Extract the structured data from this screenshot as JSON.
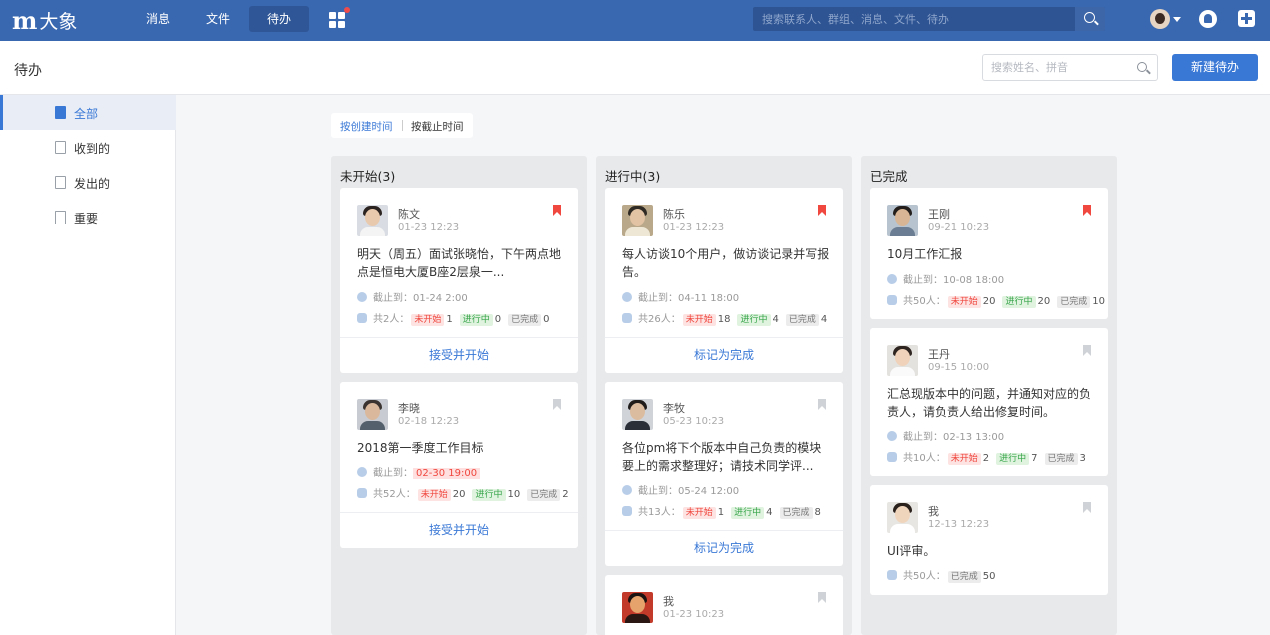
{
  "app": {
    "logo_mark": "m",
    "logo_text": "大象",
    "nav_tabs": [
      "消息",
      "文件",
      "待办"
    ],
    "global_search_placeholder": "搜索联系人、群组、消息、文件、待办"
  },
  "header": {
    "title": "待办",
    "search_placeholder": "搜索姓名、拼音",
    "new_button": "新建待办"
  },
  "sidebar": {
    "items": [
      "全部",
      "收到的",
      "发出的",
      "重要"
    ]
  },
  "sort": {
    "options": [
      "按创建时间",
      "按截止时间"
    ]
  },
  "colors": {
    "brand": "#3a68b0",
    "accent": "#3a78d6",
    "important": "#f0473f"
  },
  "columns": [
    {
      "title": "未开始(3)",
      "cards": [
        {
          "name": "陈文",
          "time": "01-23 12:23",
          "title": "明天（周五）面试张晓怡，下午两点地点是恒电大厦B座2层泉一...",
          "deadline_label": "截止到：",
          "deadline": "01-24 2:00",
          "total": "共2人：",
          "not_started_label": "未开始",
          "not_started": "1",
          "in_progress_label": "进行中",
          "in_progress": "0",
          "done_label": "已完成",
          "done": "0",
          "action": "接受并开始",
          "important": true
        },
        {
          "name": "李晓",
          "time": "02-18 12:23",
          "title": "2018第一季度工作目标",
          "deadline_label": "截止到：",
          "deadline": "02-30 19:00",
          "total": "共52人：",
          "not_started_label": "未开始",
          "not_started": "20",
          "in_progress_label": "进行中",
          "in_progress": "10",
          "done_label": "已完成",
          "done": "2",
          "action": "接受并开始",
          "important": false
        }
      ]
    },
    {
      "title": "进行中(3)",
      "cards": [
        {
          "name": "陈乐",
          "time": "01-23 12:23",
          "title": "每人访谈10个用户，做访谈记录并写报告。",
          "deadline_label": "截止到：",
          "deadline": "04-11 18:00",
          "total": "共26人：",
          "not_started_label": "未开始",
          "not_started": "18",
          "in_progress_label": "进行中",
          "in_progress": "4",
          "done_label": "已完成",
          "done": "4",
          "action": "标记为完成",
          "important": true
        },
        {
          "name": "李牧",
          "time": "05-23 10:23",
          "title": "各位pm将下个版本中自己负责的模块要上的需求整理好；请技术同学评...",
          "deadline_label": "截止到：",
          "deadline": "05-24 12:00",
          "total": "共13人：",
          "not_started_label": "未开始",
          "not_started": "1",
          "in_progress_label": "进行中",
          "in_progress": "4",
          "done_label": "已完成",
          "done": "8",
          "action": "标记为完成",
          "important": false
        },
        {
          "name": "我",
          "time": "01-23 10:23",
          "important": false
        }
      ]
    },
    {
      "title": "已完成",
      "cards": [
        {
          "name": "王刚",
          "time": "09-21 10:23",
          "title": "10月工作汇报",
          "deadline_label": "截止到：",
          "deadline": "10-08 18:00",
          "total": "共50人：",
          "not_started_label": "未开始",
          "not_started": "20",
          "in_progress_label": "进行中",
          "in_progress": "20",
          "done_label": "已完成",
          "done": "10",
          "important": true
        },
        {
          "name": "王丹",
          "time": "09-15 10:00",
          "title": "汇总现版本中的问题，并通知对应的负责人，请负责人给出修复时间。",
          "deadline_label": "截止到：",
          "deadline": "02-13 13:00",
          "total": "共10人：",
          "not_started_label": "未开始",
          "not_started": "2",
          "in_progress_label": "进行中",
          "in_progress": "7",
          "done_label": "已完成",
          "done": "3",
          "important": false
        },
        {
          "name": "我",
          "time": "12-13 12:23",
          "title": "UI评审。",
          "total": "共50人：",
          "done_label": "已完成",
          "done": "50",
          "important": false
        }
      ]
    }
  ]
}
